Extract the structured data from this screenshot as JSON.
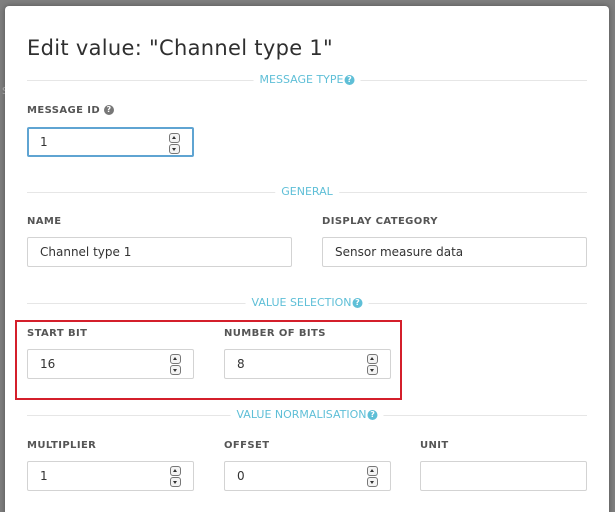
{
  "backdrop": {
    "edge_letter": "S"
  },
  "dialog": {
    "title": "Edit value: \"Channel type 1\""
  },
  "sections": {
    "message_type": {
      "label": "MESSAGE TYPE",
      "help": "?"
    },
    "general": {
      "label": "GENERAL"
    },
    "value_selection": {
      "label": "VALUE SELECTION",
      "help": "?"
    },
    "value_normalisation": {
      "label": "VALUE NORMALISATION",
      "help": "?"
    }
  },
  "fields": {
    "message_id": {
      "label": "MESSAGE ID",
      "help": "?",
      "value": "1"
    },
    "name": {
      "label": "NAME",
      "value": "Channel type 1"
    },
    "display_category": {
      "label": "DISPLAY CATEGORY",
      "value": "Sensor measure data"
    },
    "start_bit": {
      "label": "START BIT",
      "value": "16"
    },
    "number_of_bits": {
      "label": "NUMBER OF BITS",
      "value": "8"
    },
    "multiplier": {
      "label": "MULTIPLIER",
      "value": "1"
    },
    "offset": {
      "label": "OFFSET",
      "value": "0"
    },
    "unit": {
      "label": "UNIT",
      "value": ""
    }
  },
  "colors": {
    "section_accent": "#5fbfd7",
    "focus_border": "#5fa4d2",
    "highlight_border": "#d41f2b"
  },
  "icons": {
    "help": "question-circle-icon",
    "spinner_up": "caret-up-icon",
    "spinner_down": "caret-down-icon"
  }
}
